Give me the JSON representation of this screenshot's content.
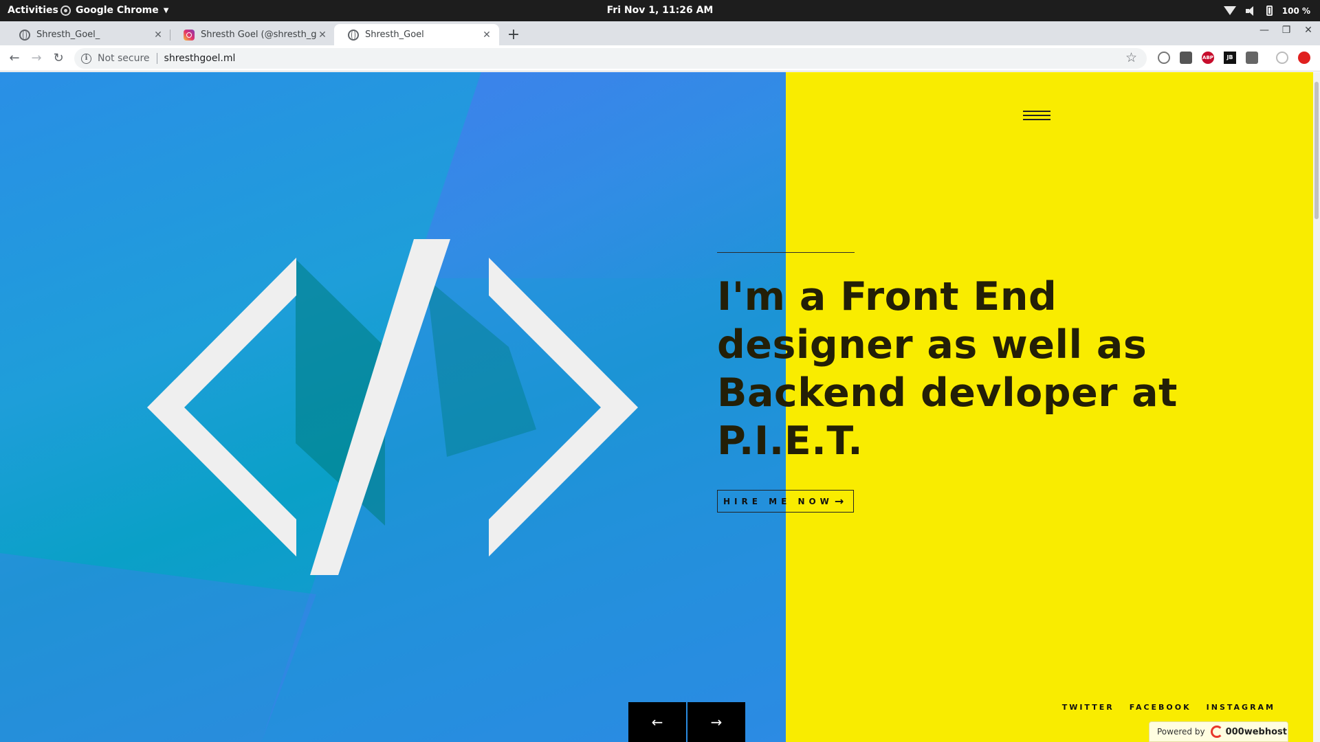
{
  "system_bar": {
    "activities": "Activities",
    "app_name": "Google Chrome",
    "clock": "Fri Nov  1, 11:26 AM",
    "battery": "100 %"
  },
  "tabs": [
    {
      "title": "Shresth_Goel_",
      "icon": "globe-icon",
      "active": false
    },
    {
      "title": "Shresth Goel (@shresth_goel",
      "icon": "instagram-icon",
      "active": false
    },
    {
      "title": "Shresth_Goel",
      "icon": "globe-icon",
      "active": true
    }
  ],
  "toolbar": {
    "security_label": "Not secure",
    "url": "shresthgoel.ml"
  },
  "hero": {
    "headline": "I'm a Front End designer as well as Backend devloper at P.I.E.T.",
    "cta_label": "HIRE ME NOW",
    "social": [
      "TWITTER",
      "FACEBOOK",
      "INSTAGRAM"
    ],
    "powered_by": "Powered by",
    "host_brand": "000webhost"
  },
  "colors": {
    "accent_yellow": "#f9ec00",
    "hero_blue": "#2a8fe6",
    "dark_text": "#231f07"
  }
}
